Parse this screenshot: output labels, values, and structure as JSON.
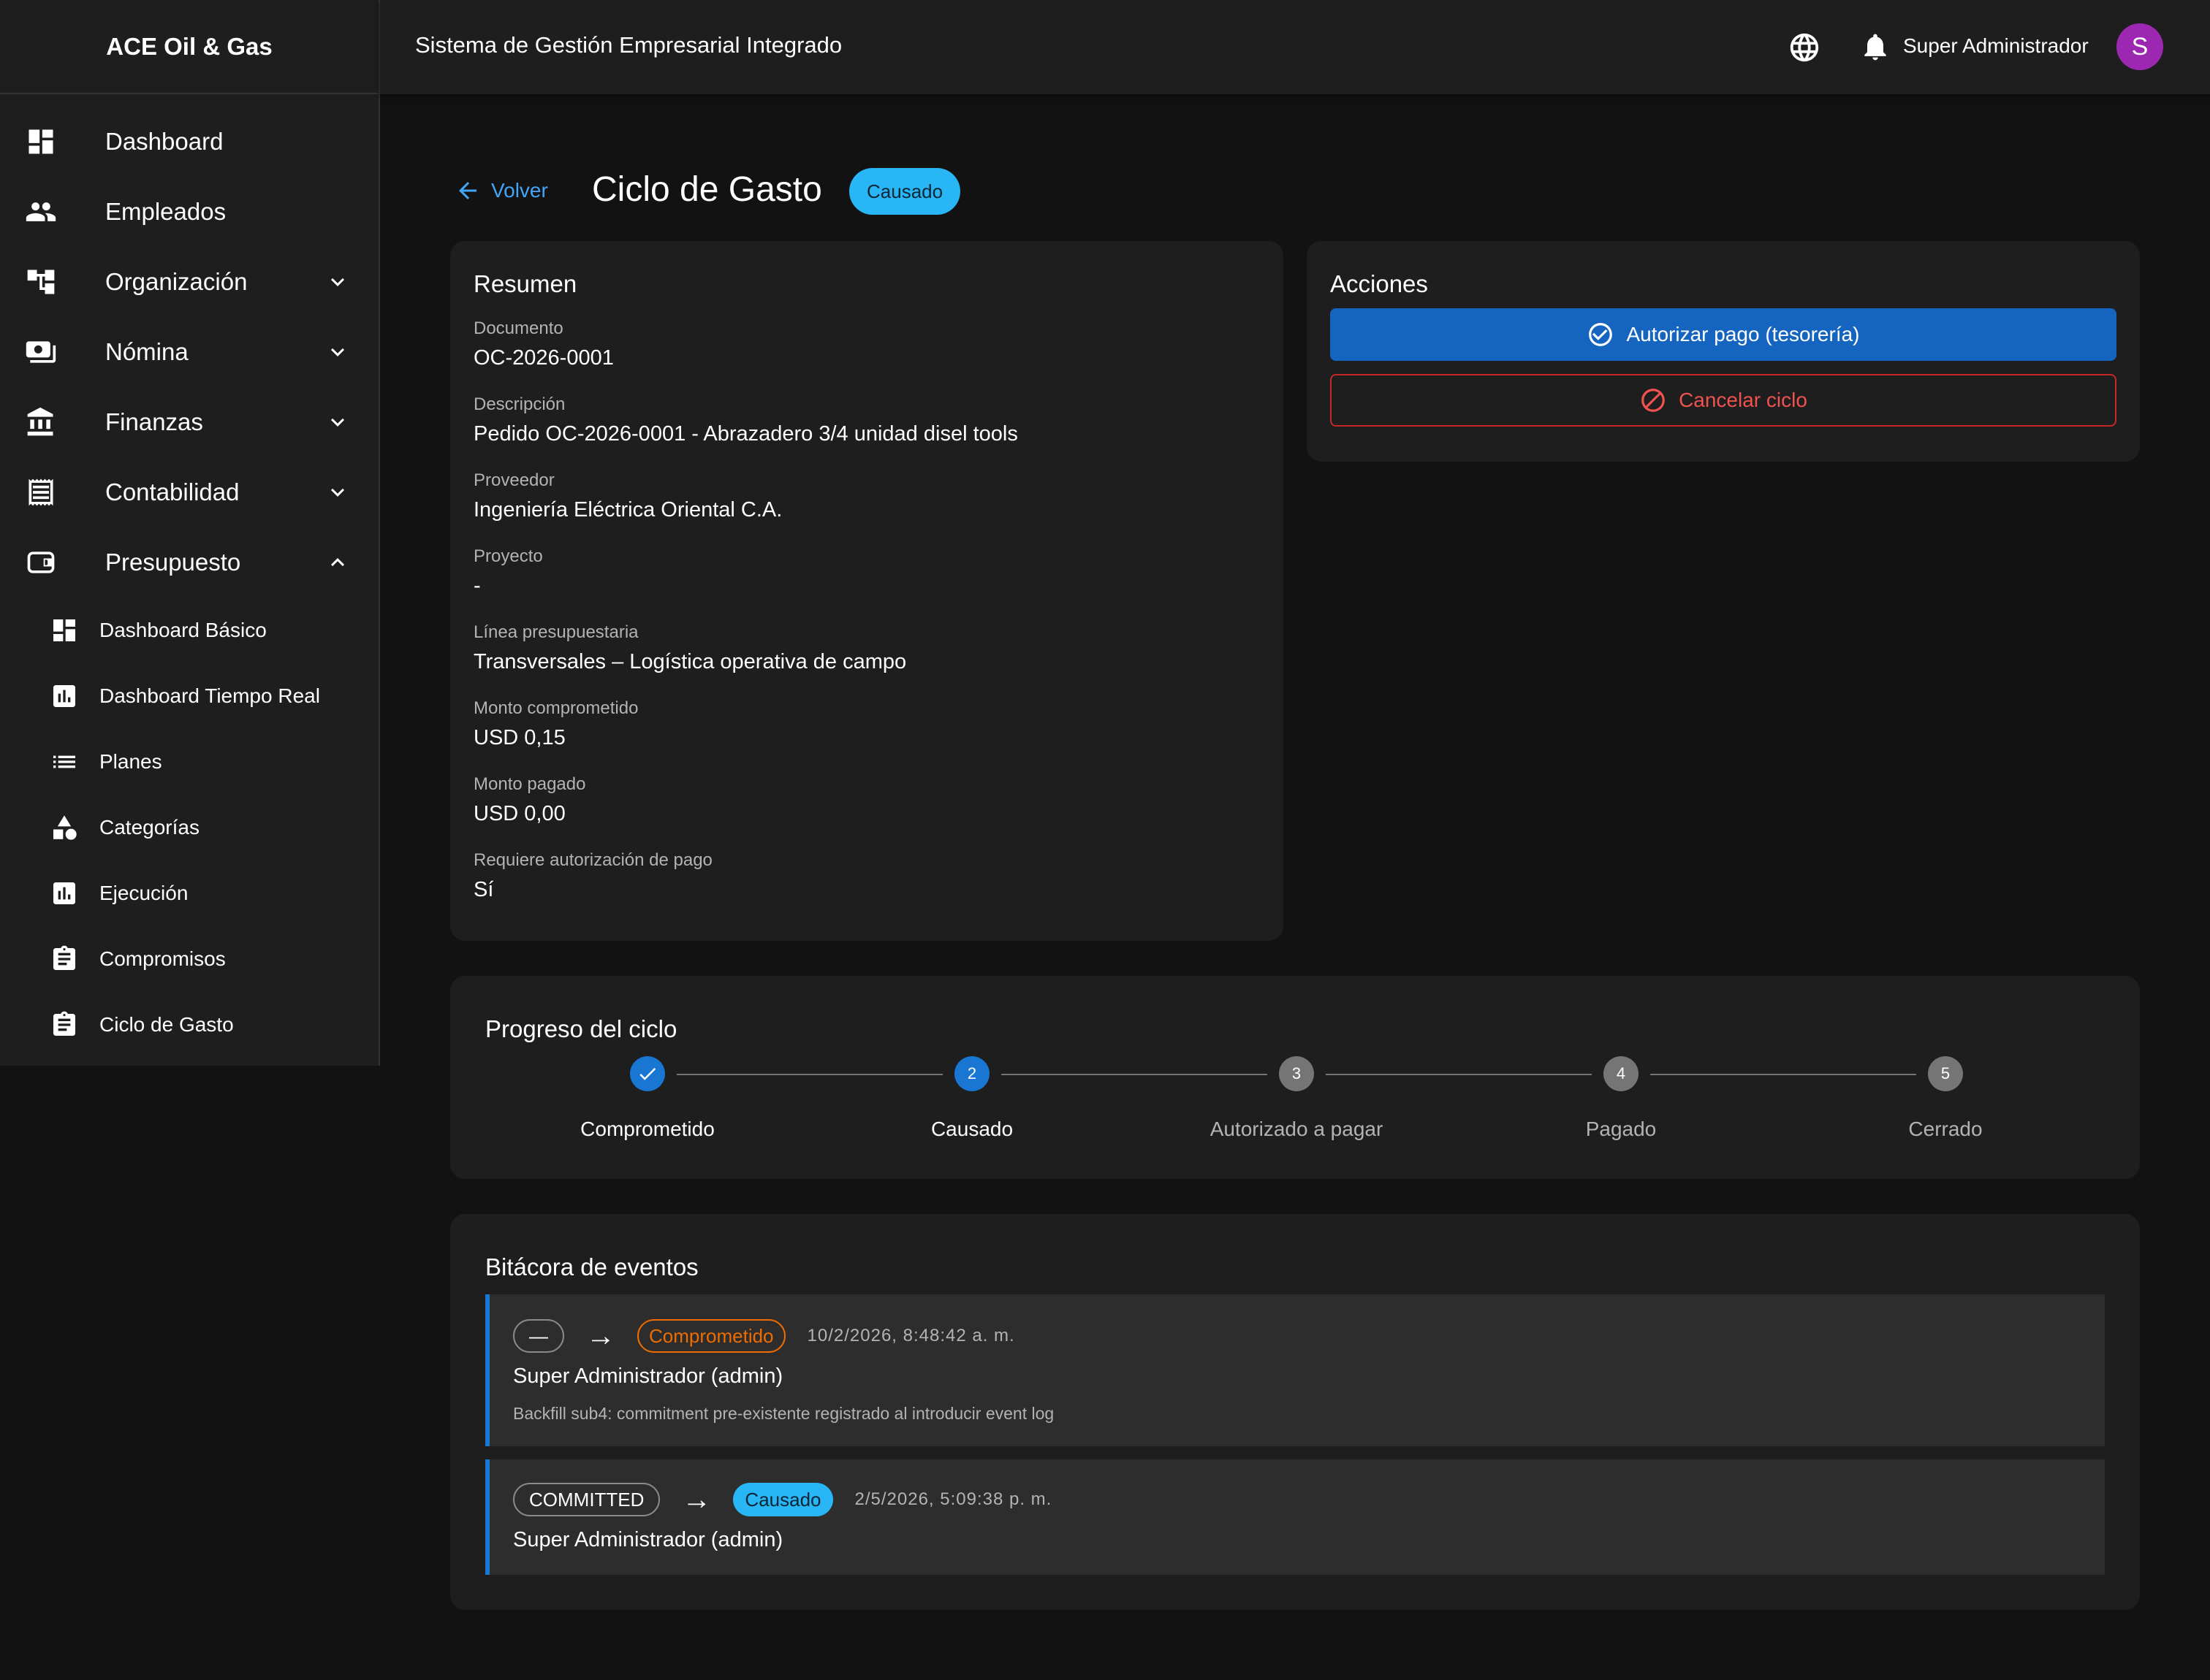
{
  "app": {
    "brand": "ACE Oil & Gas",
    "title": "Sistema de Gestión Empresarial Integrado",
    "user_name": "Super Administrador",
    "avatar_letter": "S",
    "avatar_color": "#9c27b0"
  },
  "sidebar": {
    "items": [
      {
        "label": "Dashboard",
        "icon": "dashboard-icon"
      },
      {
        "label": "Empleados",
        "icon": "people-icon"
      },
      {
        "label": "Organización",
        "icon": "org-tree-icon",
        "expanded": false
      },
      {
        "label": "Nómina",
        "icon": "payroll-icon",
        "expanded": false
      },
      {
        "label": "Finanzas",
        "icon": "bank-icon",
        "expanded": false
      },
      {
        "label": "Contabilidad",
        "icon": "receipt-icon",
        "expanded": false
      },
      {
        "label": "Presupuesto",
        "icon": "wallet-icon",
        "expanded": true
      }
    ],
    "subitems": [
      {
        "label": "Dashboard Básico",
        "icon": "dashboard-icon"
      },
      {
        "label": "Dashboard Tiempo Real",
        "icon": "bar-chart-icon"
      },
      {
        "label": "Planes",
        "icon": "list-icon"
      },
      {
        "label": "Categorías",
        "icon": "category-icon"
      },
      {
        "label": "Ejecución",
        "icon": "bar-chart-icon"
      },
      {
        "label": "Compromisos",
        "icon": "clipboard-icon"
      },
      {
        "label": "Ciclo de Gasto",
        "icon": "clipboard-icon"
      }
    ]
  },
  "header": {
    "back_label": "Volver",
    "title": "Ciclo de Gasto",
    "status": "Causado",
    "status_color": "#29b6f6"
  },
  "summary": {
    "title": "Resumen",
    "fields": [
      {
        "label": "Documento",
        "value": "OC-2026-0001"
      },
      {
        "label": "Descripción",
        "value": "Pedido OC-2026-0001 - Abrazadero 3/4 unidad disel tools"
      },
      {
        "label": "Proveedor",
        "value": "Ingeniería Eléctrica Oriental C.A."
      },
      {
        "label": "Proyecto",
        "value": "-"
      },
      {
        "label": "Línea presupuestaria",
        "value": "Transversales – Logística operativa de campo"
      },
      {
        "label": "Monto comprometido",
        "value": "USD 0,15"
      },
      {
        "label": "Monto pagado",
        "value": "USD 0,00"
      },
      {
        "label": "Requiere autorización de pago",
        "value": "Sí"
      }
    ]
  },
  "actions": {
    "title": "Acciones",
    "authorize_label": "Autorizar pago (tesorería)",
    "cancel_label": "Cancelar ciclo",
    "primary_color": "#1565c0",
    "danger_color": "#ef5350"
  },
  "progress": {
    "title": "Progreso del ciclo",
    "steps": [
      {
        "number": "1",
        "label": "Comprometido",
        "state": "done"
      },
      {
        "number": "2",
        "label": "Causado",
        "state": "active"
      },
      {
        "number": "3",
        "label": "Autorizado a pagar",
        "state": "todo"
      },
      {
        "number": "4",
        "label": "Pagado",
        "state": "todo"
      },
      {
        "number": "5",
        "label": "Cerrado",
        "state": "todo"
      }
    ]
  },
  "log": {
    "title": "Bitácora de eventos",
    "events": [
      {
        "from": "—",
        "arrow": "→",
        "to": "Comprometido",
        "timestamp": "10/2/2026, 8:48:42 a. m.",
        "actor": "Super Administrador (admin)",
        "note": "Backfill sub4: commitment pre-existente registrado al introducir event log"
      },
      {
        "from": "COMMITTED",
        "arrow": "→",
        "to": "Causado",
        "timestamp": "2/5/2026, 5:09:38 p. m.",
        "actor": "Super Administrador (admin)"
      }
    ]
  }
}
